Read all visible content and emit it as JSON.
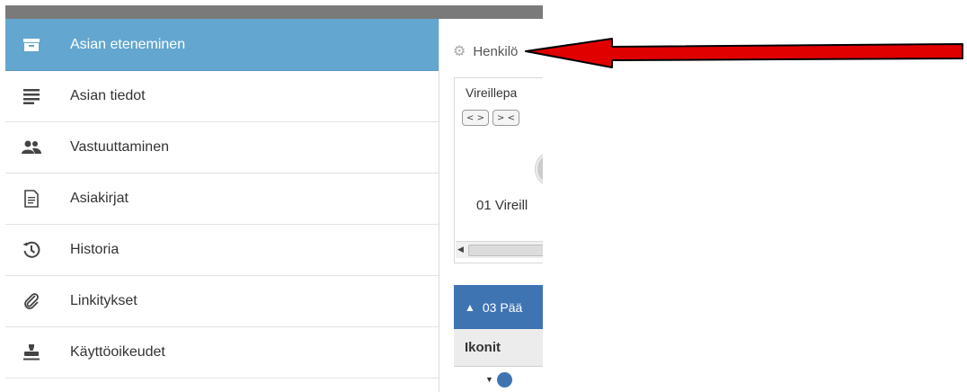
{
  "sidebar": {
    "items": [
      {
        "label": "Asian eteneminen",
        "icon": "inbox-tray-icon",
        "active": true
      },
      {
        "label": "Asian tiedot",
        "icon": "list-lines-icon",
        "active": false
      },
      {
        "label": "Vastuuttaminen",
        "icon": "users-icon",
        "active": false
      },
      {
        "label": "Asiakirjat",
        "icon": "document-icon",
        "active": false
      },
      {
        "label": "Historia",
        "icon": "history-icon",
        "active": false
      },
      {
        "label": "Linkitykset",
        "icon": "paperclip-icon",
        "active": false
      },
      {
        "label": "Käyttöoikeudet",
        "icon": "stamp-icon",
        "active": false
      }
    ]
  },
  "content": {
    "gear_text": "Henkilö",
    "panel": {
      "title": "Vireillepa",
      "btn_expand": "< >",
      "btn_collapse": "> <",
      "phase_label": "01 Vireill"
    },
    "section_bar": "03 Pää",
    "column_header": "Ikonit"
  },
  "colors": {
    "active_bg": "#63a6cf",
    "section_bg": "#3f74b3",
    "arrow": "#e00000"
  }
}
